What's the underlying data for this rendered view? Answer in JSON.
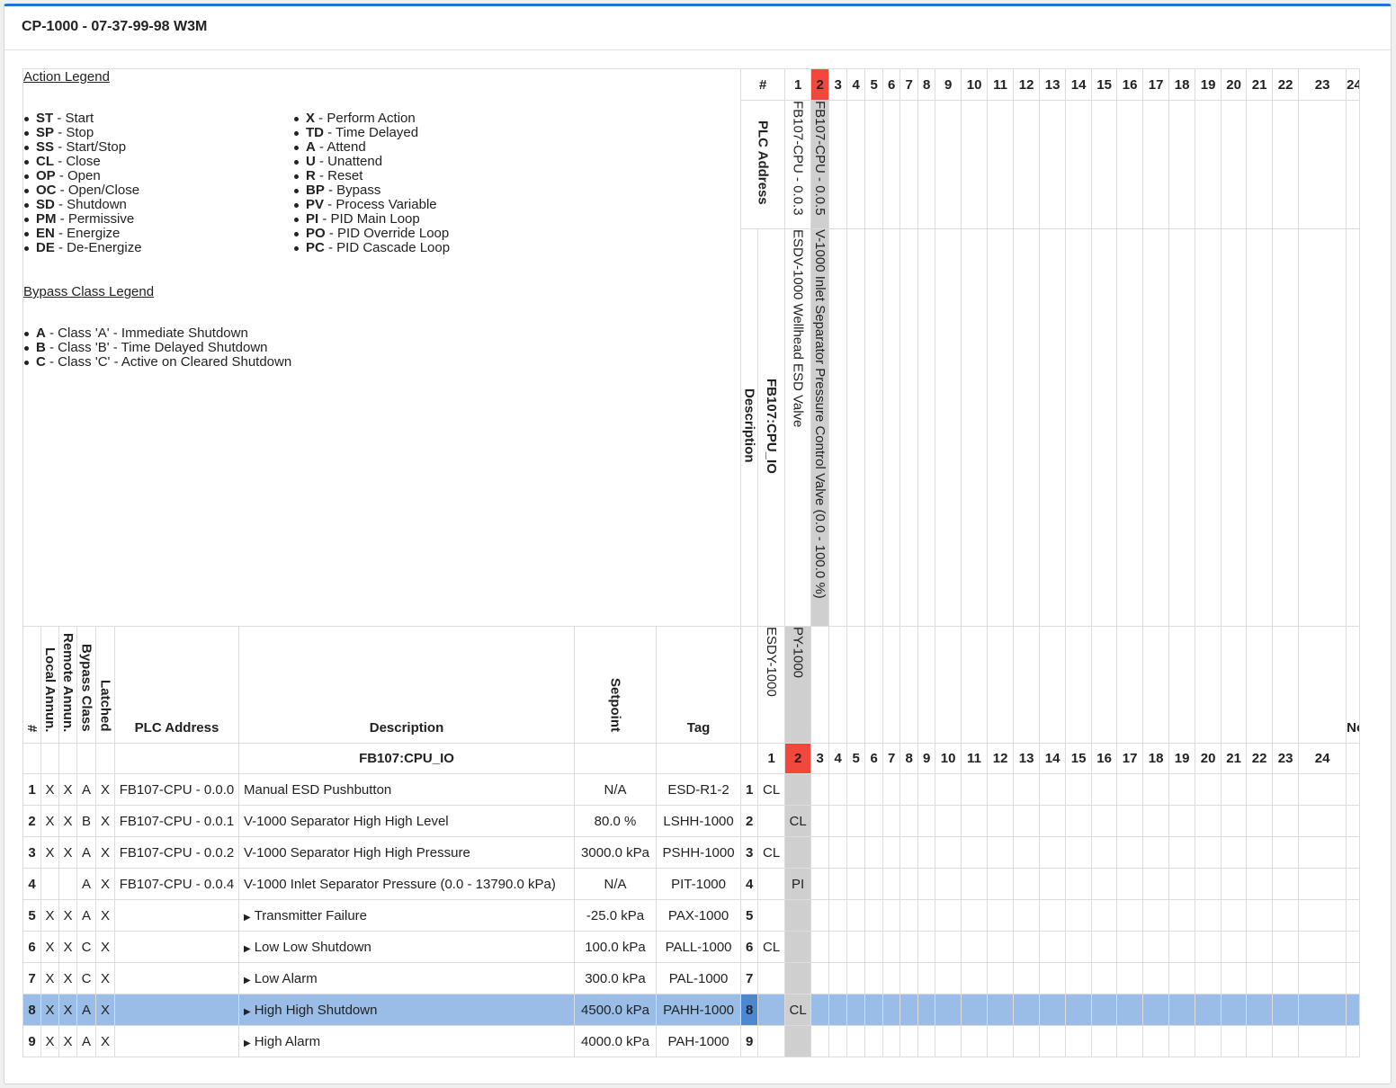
{
  "panel": {
    "title": "CP-1000 - 07-37-99-98 W3M"
  },
  "legend": {
    "action_title": "Action Legend",
    "action_left": [
      {
        "code": "ST",
        "label": " - Start"
      },
      {
        "code": "SP",
        "label": " - Stop"
      },
      {
        "code": "SS",
        "label": " - Start/Stop"
      },
      {
        "code": "CL",
        "label": " - Close"
      },
      {
        "code": "OP",
        "label": " - Open"
      },
      {
        "code": "OC",
        "label": " - Open/Close"
      },
      {
        "code": "SD",
        "label": " - Shutdown"
      },
      {
        "code": "PM",
        "label": " - Permissive"
      },
      {
        "code": "EN",
        "label": " - Energize"
      },
      {
        "code": "DE",
        "label": " - De-Energize"
      }
    ],
    "action_right": [
      {
        "code": "X",
        "label": " - Perform Action"
      },
      {
        "code": "TD",
        "label": " - Time Delayed"
      },
      {
        "code": "A",
        "label": " - Attend"
      },
      {
        "code": "U",
        "label": " - Unattend"
      },
      {
        "code": "R",
        "label": " - Reset"
      },
      {
        "code": "BP",
        "label": " - Bypass"
      },
      {
        "code": "PV",
        "label": " - Process Variable"
      },
      {
        "code": "PI",
        "label": " - PID Main Loop"
      },
      {
        "code": "PO",
        "label": " - PID Override Loop"
      },
      {
        "code": "PC",
        "label": " - PID Cascade Loop"
      }
    ],
    "bypass_title": "Bypass Class Legend",
    "bypass": [
      {
        "code": "A",
        "label": " - Class 'A' - Immediate Shutdown"
      },
      {
        "code": "B",
        "label": " - Class 'B' - Time Delayed Shutdown"
      },
      {
        "code": "C",
        "label": " - Class 'C' - Active on Cleared Shutdown"
      }
    ]
  },
  "header": {
    "hash": "#",
    "plc_address": "PLC Address",
    "description": "Description",
    "group": "FB107:CPU_IO",
    "local_annun": "Local Annun.",
    "remote_annun": "Remote Annun.",
    "bypass_class": "Bypass Class",
    "latched": "Latched",
    "setpoint": "Setpoint",
    "tag": "Tag",
    "notes": "Notes"
  },
  "outputs": [
    {
      "num": "1",
      "plc": "FB107-CPU - 0.0.3",
      "desc": "ESDV-1000 Wellhead ESD Valve",
      "tag": "ESDY-1000"
    },
    {
      "num": "2",
      "plc": "FB107-CPU - 0.0.5",
      "desc": "V-1000 Inlet Separator Pressure Control Valve (0.0 - 100.0 %)",
      "tag": "PY-1000"
    }
  ],
  "column_numbers": [
    "1",
    "2",
    "3",
    "4",
    "5",
    "6",
    "7",
    "8",
    "9",
    "10",
    "11",
    "12",
    "13",
    "14",
    "15",
    "16",
    "17",
    "18",
    "19",
    "20",
    "21",
    "22",
    "23",
    "24"
  ],
  "rows": [
    {
      "num": "1",
      "local": "X",
      "remote": "X",
      "bypass": "A",
      "latched": "X",
      "plc": "FB107-CPU - 0.0.0",
      "desc": "Manual ESD Pushbutton",
      "setpoint": "N/A",
      "tag": "ESD-R1-2",
      "c1": "CL",
      "c2": ""
    },
    {
      "num": "2",
      "local": "X",
      "remote": "X",
      "bypass": "B",
      "latched": "X",
      "plc": "FB107-CPU - 0.0.1",
      "desc": "V-1000 Separator High High Level",
      "setpoint": "80.0 %",
      "tag": "LSHH-1000",
      "c1": "",
      "c2": "CL"
    },
    {
      "num": "3",
      "local": "X",
      "remote": "X",
      "bypass": "A",
      "latched": "X",
      "plc": "FB107-CPU - 0.0.2",
      "desc": "V-1000 Separator High High Pressure",
      "setpoint": "3000.0 kPa",
      "tag": "PSHH-1000",
      "c1": "CL",
      "c2": ""
    },
    {
      "num": "4",
      "local": "",
      "remote": "",
      "bypass": "A",
      "latched": "X",
      "plc": "FB107-CPU - 0.0.4",
      "desc": "V-1000 Inlet Separator Pressure (0.0 - 13790.0 kPa)",
      "setpoint": "N/A",
      "tag": "PIT-1000",
      "c1": "",
      "c2": "PI"
    },
    {
      "num": "5",
      "local": "X",
      "remote": "X",
      "bypass": "A",
      "latched": "X",
      "plc": "",
      "desc": "Transmitter Failure",
      "setpoint": "-25.0 kPa",
      "tag": "PAX-1000",
      "c1": "",
      "c2": ""
    },
    {
      "num": "6",
      "local": "X",
      "remote": "X",
      "bypass": "C",
      "latched": "X",
      "plc": "",
      "desc": "Low Low Shutdown",
      "setpoint": "100.0 kPa",
      "tag": "PALL-1000",
      "c1": "CL",
      "c2": ""
    },
    {
      "num": "7",
      "local": "X",
      "remote": "X",
      "bypass": "C",
      "latched": "X",
      "plc": "",
      "desc": "Low Alarm",
      "setpoint": "300.0 kPa",
      "tag": "PAL-1000",
      "c1": "",
      "c2": ""
    },
    {
      "num": "8",
      "local": "X",
      "remote": "X",
      "bypass": "A",
      "latched": "X",
      "plc": "",
      "desc": "High High Shutdown",
      "setpoint": "4500.0 kPa",
      "tag": "PAHH-1000",
      "c1": "",
      "c2": "CL"
    },
    {
      "num": "9",
      "local": "X",
      "remote": "X",
      "bypass": "A",
      "latched": "X",
      "plc": "",
      "desc": "High Alarm",
      "setpoint": "4000.0 kPa",
      "tag": "PAH-1000",
      "c1": "",
      "c2": ""
    }
  ],
  "arrow_glyph": "▶",
  "colors": {
    "accent": "#1f74d4",
    "selected_col": "#f2473d",
    "selected_row": "#99bde6",
    "output_col_fill": "#cfcfcf"
  }
}
